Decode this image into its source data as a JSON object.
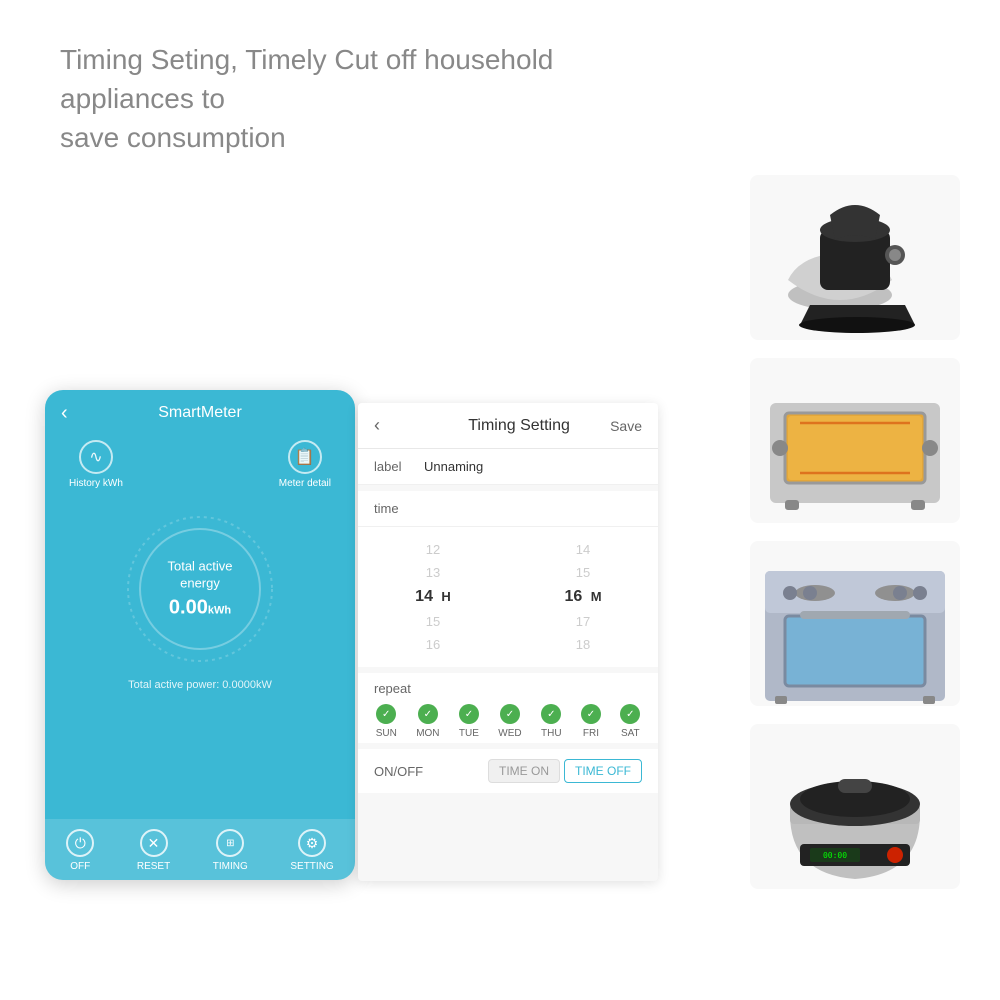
{
  "header": {
    "line1": "Timing Seting, Timely Cut off household appliances to",
    "line2": "save consumption"
  },
  "phone": {
    "title": "SmartMeter",
    "back_arrow": "‹",
    "history_kwh_label": "History kWh",
    "meter_detail_label": "Meter detail",
    "gauge_label": "Total active\nenergy",
    "gauge_value": "0.00",
    "gauge_unit": "kWh",
    "total_power_label": "Total active power: 0.0000kW",
    "footer": [
      {
        "icon": "⏻",
        "label": "OFF"
      },
      {
        "icon": "✕",
        "label": "RESET"
      },
      {
        "icon": "⊞",
        "label": "TIMING"
      },
      {
        "icon": "⚙",
        "label": "SETTING"
      }
    ]
  },
  "timing": {
    "title": "Timing Setting",
    "back": "‹",
    "save": "Save",
    "label_field": "label",
    "label_value": "Unnaming",
    "time_field": "time",
    "hours_above": [
      "12",
      "13"
    ],
    "hours_selected": "14",
    "hours_unit": "H",
    "hours_below": [
      "15",
      "16"
    ],
    "mins_above": [
      "14",
      "15"
    ],
    "mins_selected": "16",
    "mins_unit": "M",
    "mins_below": [
      "17",
      "18"
    ],
    "repeat_label": "repeat",
    "days": [
      "SUN",
      "MON",
      "TUE",
      "WED",
      "THU",
      "FRI",
      "SAT"
    ],
    "onoff_label": "ON/OFF",
    "btn_time_on": "TIME ON",
    "btn_time_off": "TIME OFF",
    "active_btn": "time-off"
  },
  "appliances": [
    {
      "name": "stand-mixer",
      "type": "mixer"
    },
    {
      "name": "toaster-oven",
      "type": "toaster"
    },
    {
      "name": "electric-stove",
      "type": "oven"
    },
    {
      "name": "rice-cooker",
      "type": "ricecooker"
    }
  ]
}
